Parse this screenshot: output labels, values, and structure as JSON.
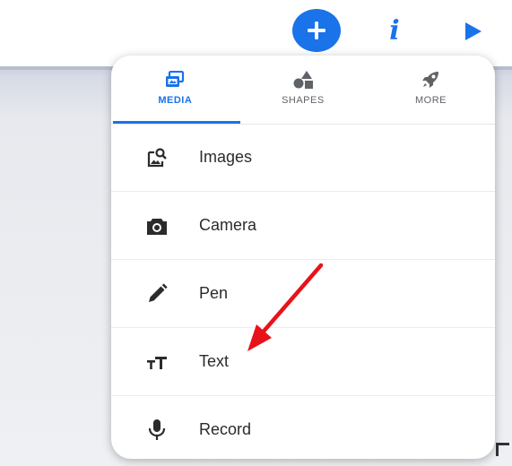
{
  "toolbar": {
    "add_icon": "plus-icon",
    "info_label": "i",
    "play_icon": "play-icon",
    "accent_color": "#1a73e8"
  },
  "popup": {
    "tabs": [
      {
        "label": "MEDIA",
        "icon": "media-icon",
        "active": true
      },
      {
        "label": "SHAPES",
        "icon": "shapes-icon",
        "active": false
      },
      {
        "label": "MORE",
        "icon": "rocket-icon",
        "active": false
      }
    ],
    "items": [
      {
        "label": "Images",
        "icon": "image-search-icon"
      },
      {
        "label": "Camera",
        "icon": "camera-icon"
      },
      {
        "label": "Pen",
        "icon": "pen-icon"
      },
      {
        "label": "Text",
        "icon": "text-size-icon"
      },
      {
        "label": "Record",
        "icon": "microphone-icon"
      }
    ]
  },
  "annotation": {
    "type": "arrow",
    "color": "#e8121a",
    "points_to": "Text"
  }
}
